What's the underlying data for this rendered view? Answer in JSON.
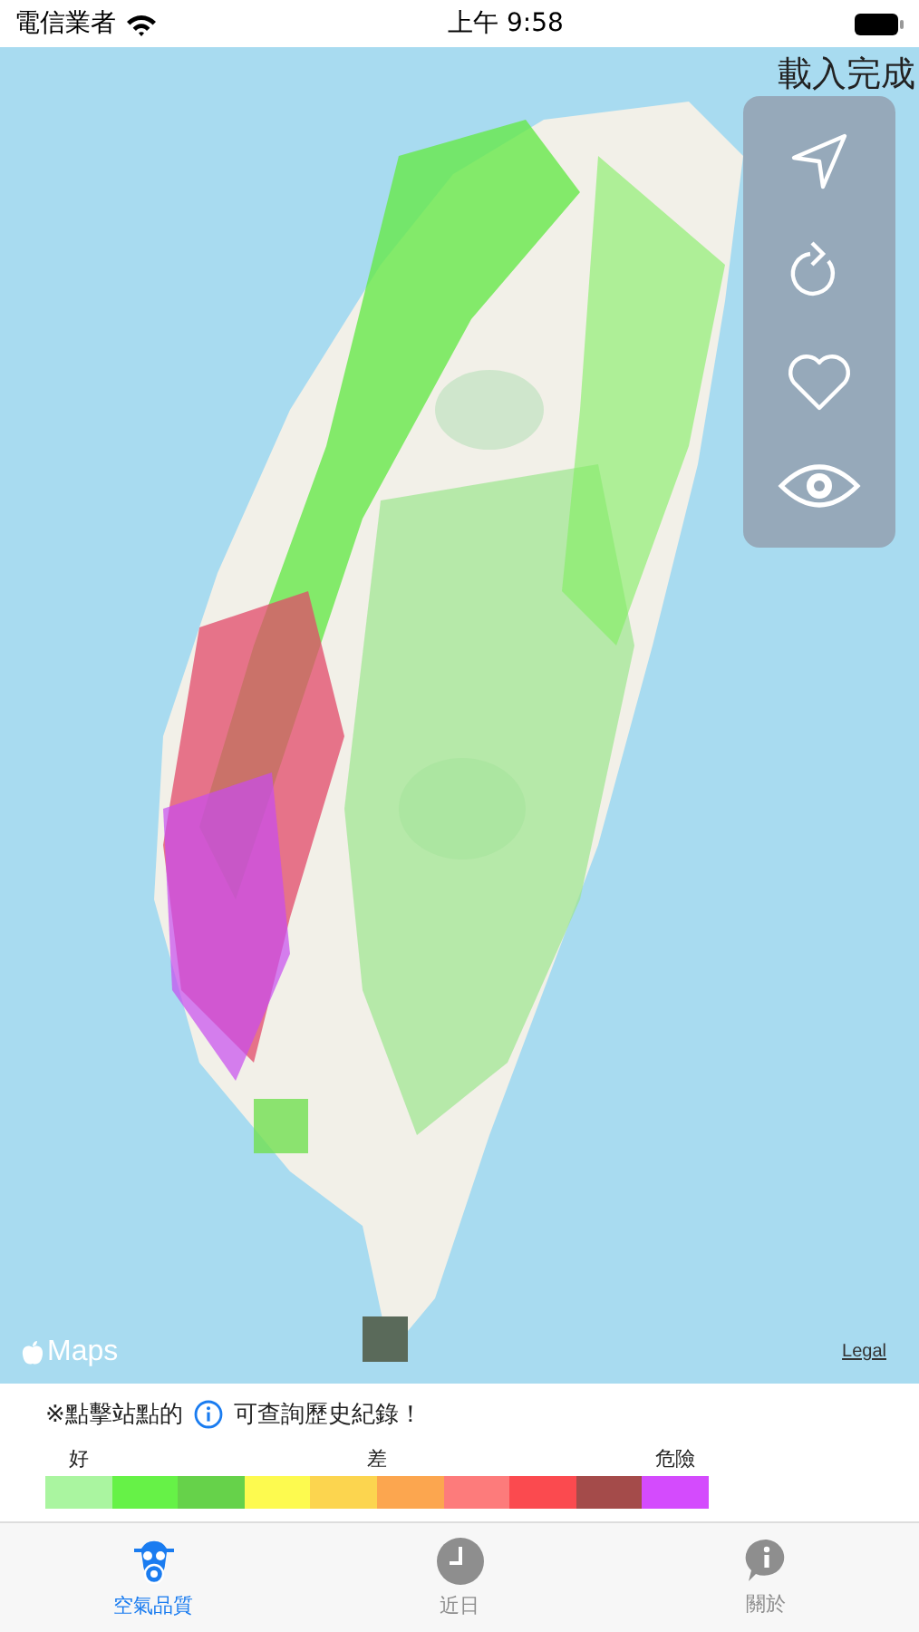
{
  "status_bar": {
    "carrier": "電信業者",
    "time": "上午 9:58"
  },
  "map": {
    "kind": "picture",
    "load_status": "載入完成",
    "attribution": "Maps",
    "legal": "Legal"
  },
  "legend": {
    "hint_before": "※點擊站點的",
    "hint_after": "可查詢歷史紀錄！",
    "labels": [
      "好",
      "差",
      "危險"
    ],
    "colors": [
      {
        "color": "#aaf5a0"
      },
      {
        "color": "#66f247"
      },
      {
        "color": "#66d24a"
      },
      {
        "color": "#fdfa4f"
      },
      {
        "color": "#fcd54f"
      },
      {
        "color": "#fca64f"
      },
      {
        "color": "#fd7b7b"
      },
      {
        "color": "#fb4a4f"
      },
      {
        "color": "#a44b4a"
      },
      {
        "color": "#d44bfd"
      }
    ]
  },
  "tabs": [
    {
      "label": "空氣品質",
      "selected": true
    },
    {
      "label": "近日",
      "selected": false
    },
    {
      "label": "關於",
      "selected": false
    }
  ]
}
